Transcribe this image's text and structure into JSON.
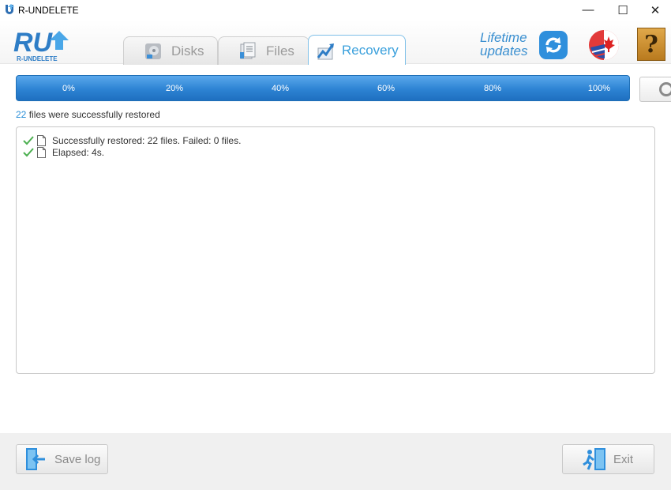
{
  "window": {
    "title": "R-UNDELETE",
    "minimize": "—",
    "maximize": "☐",
    "close": "✕"
  },
  "logo": {
    "text": "RU",
    "subtitle": "R-UNDELETE"
  },
  "tabs": [
    {
      "label": "Disks",
      "icon": "disk-icon",
      "active": false
    },
    {
      "label": "Files",
      "icon": "files-icon",
      "active": false
    },
    {
      "label": "Recovery",
      "icon": "recovery-chart-icon",
      "active": true
    }
  ],
  "header": {
    "lifetime_line1": "Lifetime",
    "lifetime_line2": "updates",
    "help_label": "?"
  },
  "progress": {
    "value_percent": 100,
    "ticks": [
      "0%",
      "20%",
      "40%",
      "60%",
      "80%",
      "100%"
    ]
  },
  "status": {
    "count": "22",
    "text": " files were successfully restored"
  },
  "log": [
    {
      "text": "Successfully restored: 22 files. Failed: 0 files.",
      "status_icon": "check-icon"
    },
    {
      "text": "Elapsed: 4s.",
      "status_icon": "check-icon"
    }
  ],
  "buttons": {
    "save_log": "Save log",
    "exit": "Exit"
  },
  "colors": {
    "accent": "#2a8fd8",
    "progress_bar": "#2d83d3",
    "check": "#4caf50"
  }
}
